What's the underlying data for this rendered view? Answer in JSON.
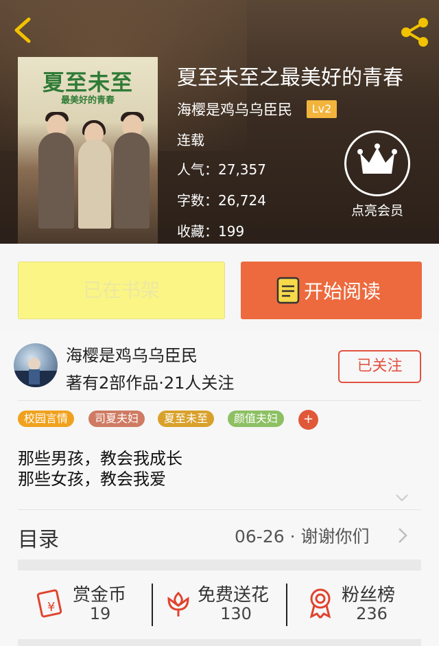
{
  "header": {
    "book_title": "夏至未至之最美好的青春",
    "author": "海樱是鸡乌乌臣民",
    "level": "Lv2",
    "status": "连载",
    "stats": [
      {
        "label": "人气：",
        "value": "27,357"
      },
      {
        "label": "字数：",
        "value": "26,724"
      },
      {
        "label": "收藏：",
        "value": "199"
      }
    ],
    "vip_label": "点亮会员",
    "cover": {
      "title": "夏至未至",
      "subtitle": "最美好的青春"
    }
  },
  "buttons": {
    "shelf": "已在书架",
    "read": "开始阅读"
  },
  "author_card": {
    "name": "海樱是鸡乌乌臣民",
    "summary": "著有2部作品·21人关注",
    "follow": "已关注"
  },
  "tags": [
    {
      "label": "校园言情",
      "color": "#f0a21e"
    },
    {
      "label": "司夏夫妇",
      "color": "#cf7b63"
    },
    {
      "label": "夏至未至",
      "color": "#d9a12c"
    },
    {
      "label": "颜值夫妇",
      "color": "#8dc063"
    }
  ],
  "tag_more": "+",
  "description": [
    "那些男孩，教会我成长",
    "那些女孩，教会我爱"
  ],
  "toc": {
    "title": "目录",
    "latest": "06-26 · 谢谢你们"
  },
  "actions": [
    {
      "name": "赏金币",
      "count": "19",
      "icon": "red-envelope-icon"
    },
    {
      "name": "免费送花",
      "count": "130",
      "icon": "flower-icon"
    },
    {
      "name": "粉丝榜",
      "count": "236",
      "icon": "medal-icon"
    }
  ],
  "colors": {
    "accent": "#ec6a3e",
    "shelf_button": "#fbf586",
    "follow": "#e25141",
    "level_badge": "#f2b43c"
  }
}
